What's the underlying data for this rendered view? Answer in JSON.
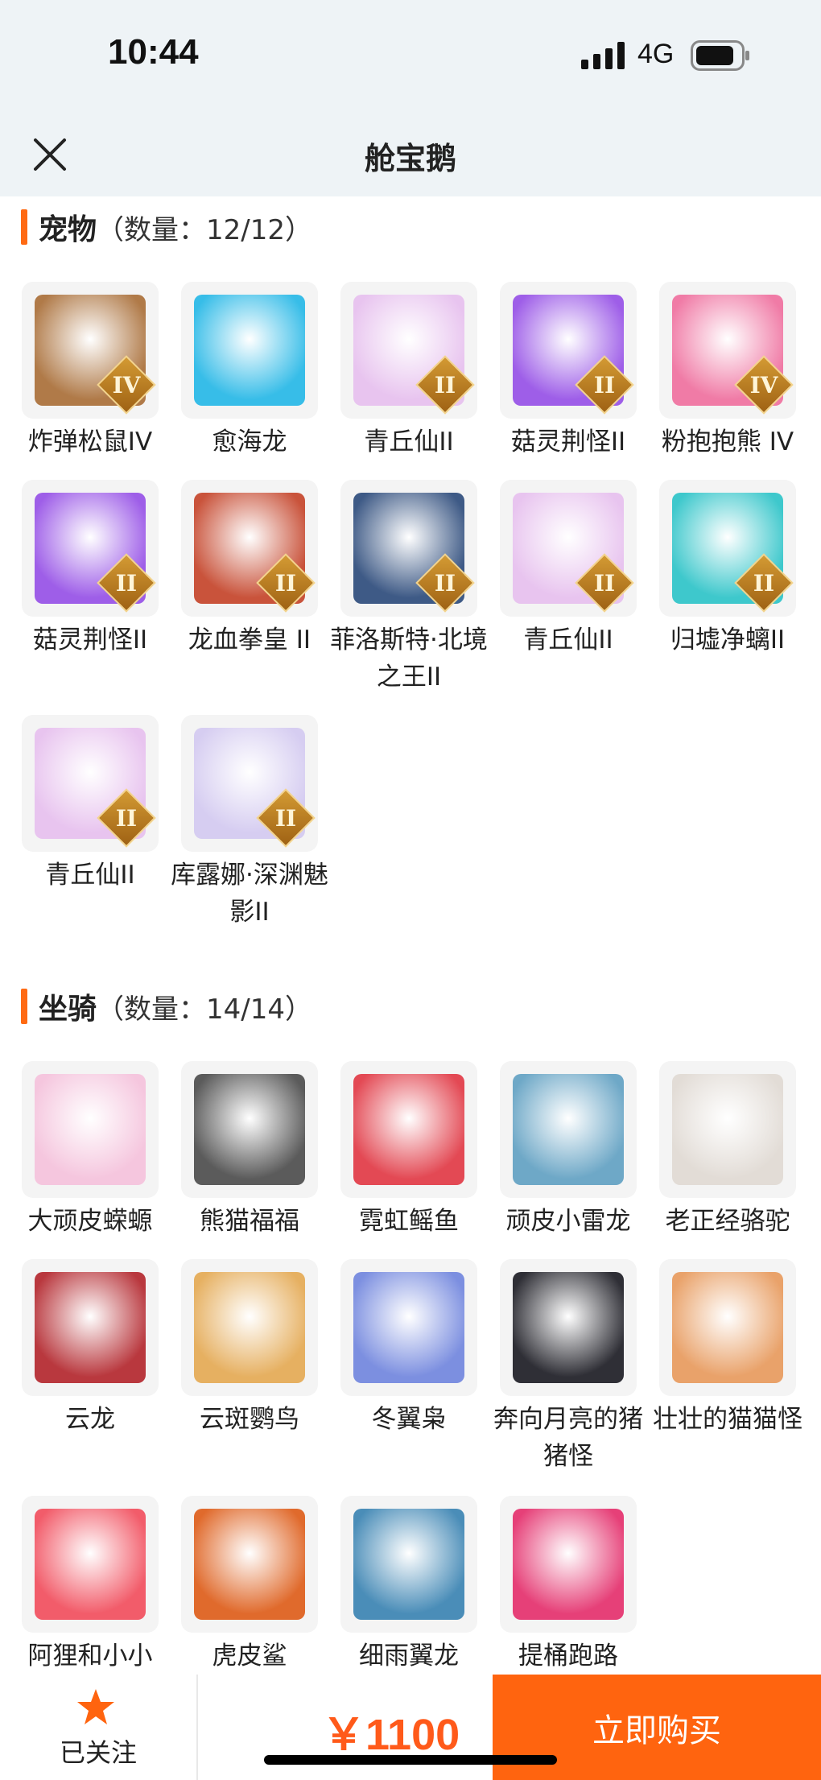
{
  "status": {
    "time": "10:44",
    "network": "4G"
  },
  "header": {
    "title": "舱宝鹅"
  },
  "pets": {
    "title": "宠物",
    "count": "（数量：12/12）",
    "items": [
      {
        "name": "炸弹松鼠IV",
        "rank": "IV",
        "color": "#b07a48"
      },
      {
        "name": "愈海龙",
        "rank": "",
        "color": "#37bde8"
      },
      {
        "name": "青丘仙II",
        "rank": "II",
        "color": "#e8c4ef"
      },
      {
        "name": "菇灵荆怪II",
        "rank": "II",
        "color": "#9e5ee8"
      },
      {
        "name": "粉抱抱熊 IV",
        "rank": "IV",
        "color": "#f07ba6"
      },
      {
        "name": "菇灵荆怪II",
        "rank": "II",
        "color": "#9e5ee8"
      },
      {
        "name": "龙血拳皇 II",
        "rank": "II",
        "color": "#c9533b"
      },
      {
        "name": "菲洛斯特·北境之王II",
        "rank": "II",
        "color": "#3e5a86"
      },
      {
        "name": "青丘仙II",
        "rank": "II",
        "color": "#e8c4ef"
      },
      {
        "name": "归墟净螭II",
        "rank": "II",
        "color": "#3ec8cc"
      },
      {
        "name": "青丘仙II",
        "rank": "II",
        "color": "#e8c4ef"
      },
      {
        "name": "库露娜·深渊魅影II",
        "rank": "II",
        "color": "#d6cdf1"
      }
    ]
  },
  "mounts": {
    "title": "坐骑",
    "count": "（数量：14/14）",
    "items": [
      {
        "name": "大顽皮蝾螈",
        "color": "#f5c6de"
      },
      {
        "name": "熊猫福福",
        "color": "#5b5b5b"
      },
      {
        "name": "霓虹鳐鱼",
        "color": "#e34954"
      },
      {
        "name": "顽皮小雷龙",
        "color": "#6ea8c7"
      },
      {
        "name": "老正经骆驼",
        "color": "#e2dcd6"
      },
      {
        "name": "云龙",
        "color": "#b9383e"
      },
      {
        "name": "云斑鹦鸟",
        "color": "#e6b061"
      },
      {
        "name": "冬翼枭",
        "color": "#7c8fe0"
      },
      {
        "name": "奔向月亮的猪猪怪",
        "color": "#2f2f36"
      },
      {
        "name": "壮壮的猫猫怪",
        "color": "#e9a26a"
      },
      {
        "name": "阿狸和小小",
        "color": "#f25c6a"
      },
      {
        "name": "虎皮鲨",
        "color": "#e06a2c"
      },
      {
        "name": "细雨翼龙",
        "color": "#4a8db8"
      },
      {
        "name": "提桶跑路",
        "color": "#e64078"
      }
    ]
  },
  "footer": {
    "follow_label": "已关注",
    "price": "￥1100",
    "buy_label": "立即购买"
  },
  "colors": {
    "accent": "#ff640f",
    "price": "#ff5a1a"
  }
}
